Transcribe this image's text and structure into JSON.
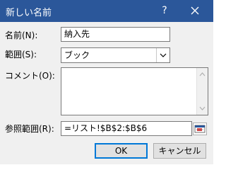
{
  "window": {
    "title": "新しい名前",
    "help_label": "?"
  },
  "form": {
    "name_label": "名前(N):",
    "name_value": "納入先",
    "scope_label": "範囲(S):",
    "scope_value": "ブック",
    "comment_label": "コメント(O):",
    "comment_value": "",
    "refers_label": "参照範囲(R):",
    "refers_value": "=リスト!$B$2:$B$6"
  },
  "buttons": {
    "ok_label": "OK",
    "cancel_label": "キャンセル"
  },
  "icons": {
    "close": "close-icon",
    "dropdown": "chevron-down-icon",
    "scroll_up": "scroll-up-icon",
    "scroll_down": "scroll-down-icon",
    "collapse_dialog": "collapse-dialog-icon"
  },
  "colors": {
    "titlebar": "#2b579a",
    "default_button_border": "#0078d7"
  }
}
